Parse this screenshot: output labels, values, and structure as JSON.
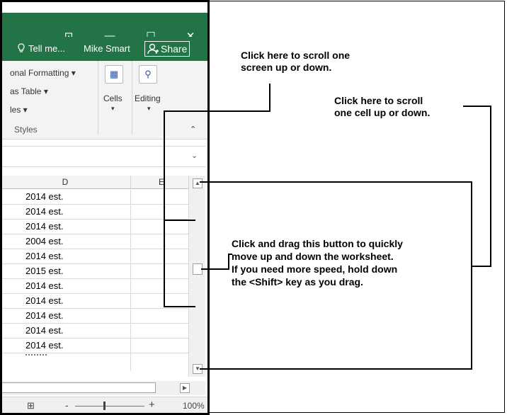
{
  "excel": {
    "window_controls": [
      "⊡",
      "—",
      "☐",
      "✕"
    ],
    "tell_me": "Tell me...",
    "user": "Mike Smart",
    "share": "Share",
    "ribbon": {
      "conditional_formatting": "onal Formatting",
      "format_as_table": "as Table",
      "cell_styles": "les",
      "group_label": "Styles",
      "cells_label": "Cells",
      "editing_label": "Editing"
    },
    "columns": [
      "D",
      "E"
    ],
    "rows": [
      "2014 est.",
      "2014 est.",
      "2014 est.",
      "2004 est.",
      "2014 est.",
      "2015 est.",
      "2014 est.",
      "2014 est.",
      "2014 est.",
      "2014 est.",
      "2014 est."
    ],
    "zoom": "100%",
    "zoom_minus": "-",
    "zoom_plus": "+"
  },
  "callouts": {
    "screen": [
      "Click here to scroll one",
      "screen up or down."
    ],
    "cell": [
      "Click here to scroll",
      "one cell up or down."
    ],
    "drag": [
      "Click and drag this button to quickly",
      "move up and down the worksheet.",
      "If you need more speed, hold down",
      "the <Shift> key as you drag."
    ]
  }
}
